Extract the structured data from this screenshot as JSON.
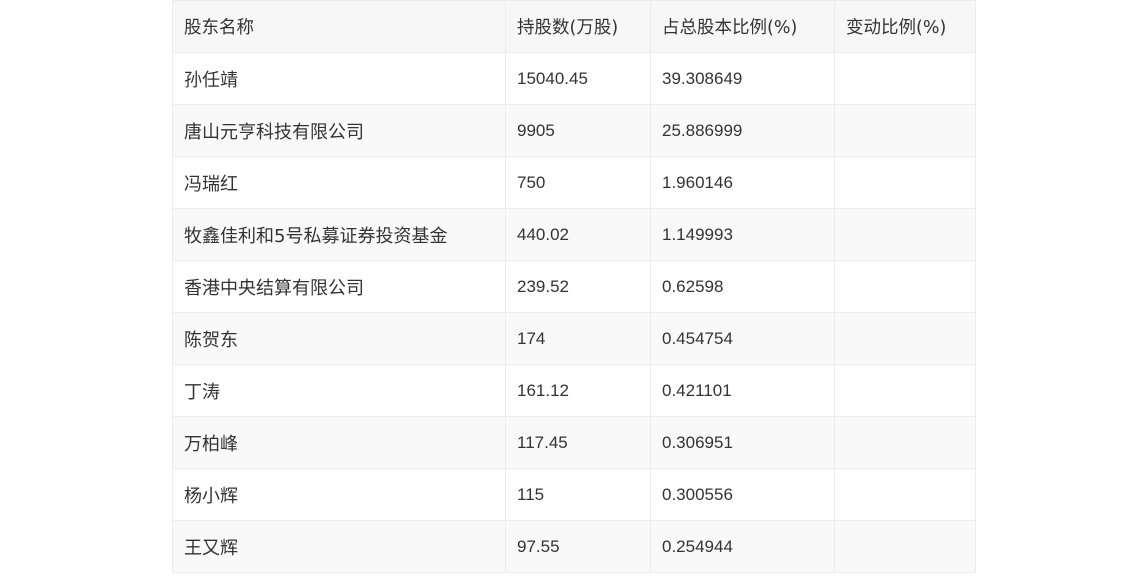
{
  "table": {
    "headers": [
      "股东名称",
      "持股数(万股)",
      "占总股本比例(%)",
      "变动比例(%)"
    ],
    "rows": [
      [
        "孙任靖",
        "15040.45",
        "39.308649",
        ""
      ],
      [
        "唐山元亨科技有限公司",
        "9905",
        "25.886999",
        ""
      ],
      [
        "冯瑞红",
        "750",
        "1.960146",
        ""
      ],
      [
        "牧鑫佳利和5号私募证券投资基金",
        "440.02",
        "1.149993",
        ""
      ],
      [
        "香港中央结算有限公司",
        "239.52",
        "0.62598",
        ""
      ],
      [
        "陈贺东",
        "174",
        "0.454754",
        ""
      ],
      [
        "丁涛",
        "161.12",
        "0.421101",
        ""
      ],
      [
        "万柏峰",
        "117.45",
        "0.306951",
        ""
      ],
      [
        "杨小辉",
        "115",
        "0.300556",
        ""
      ],
      [
        "王又辉",
        "97.55",
        "0.254944",
        ""
      ]
    ]
  }
}
